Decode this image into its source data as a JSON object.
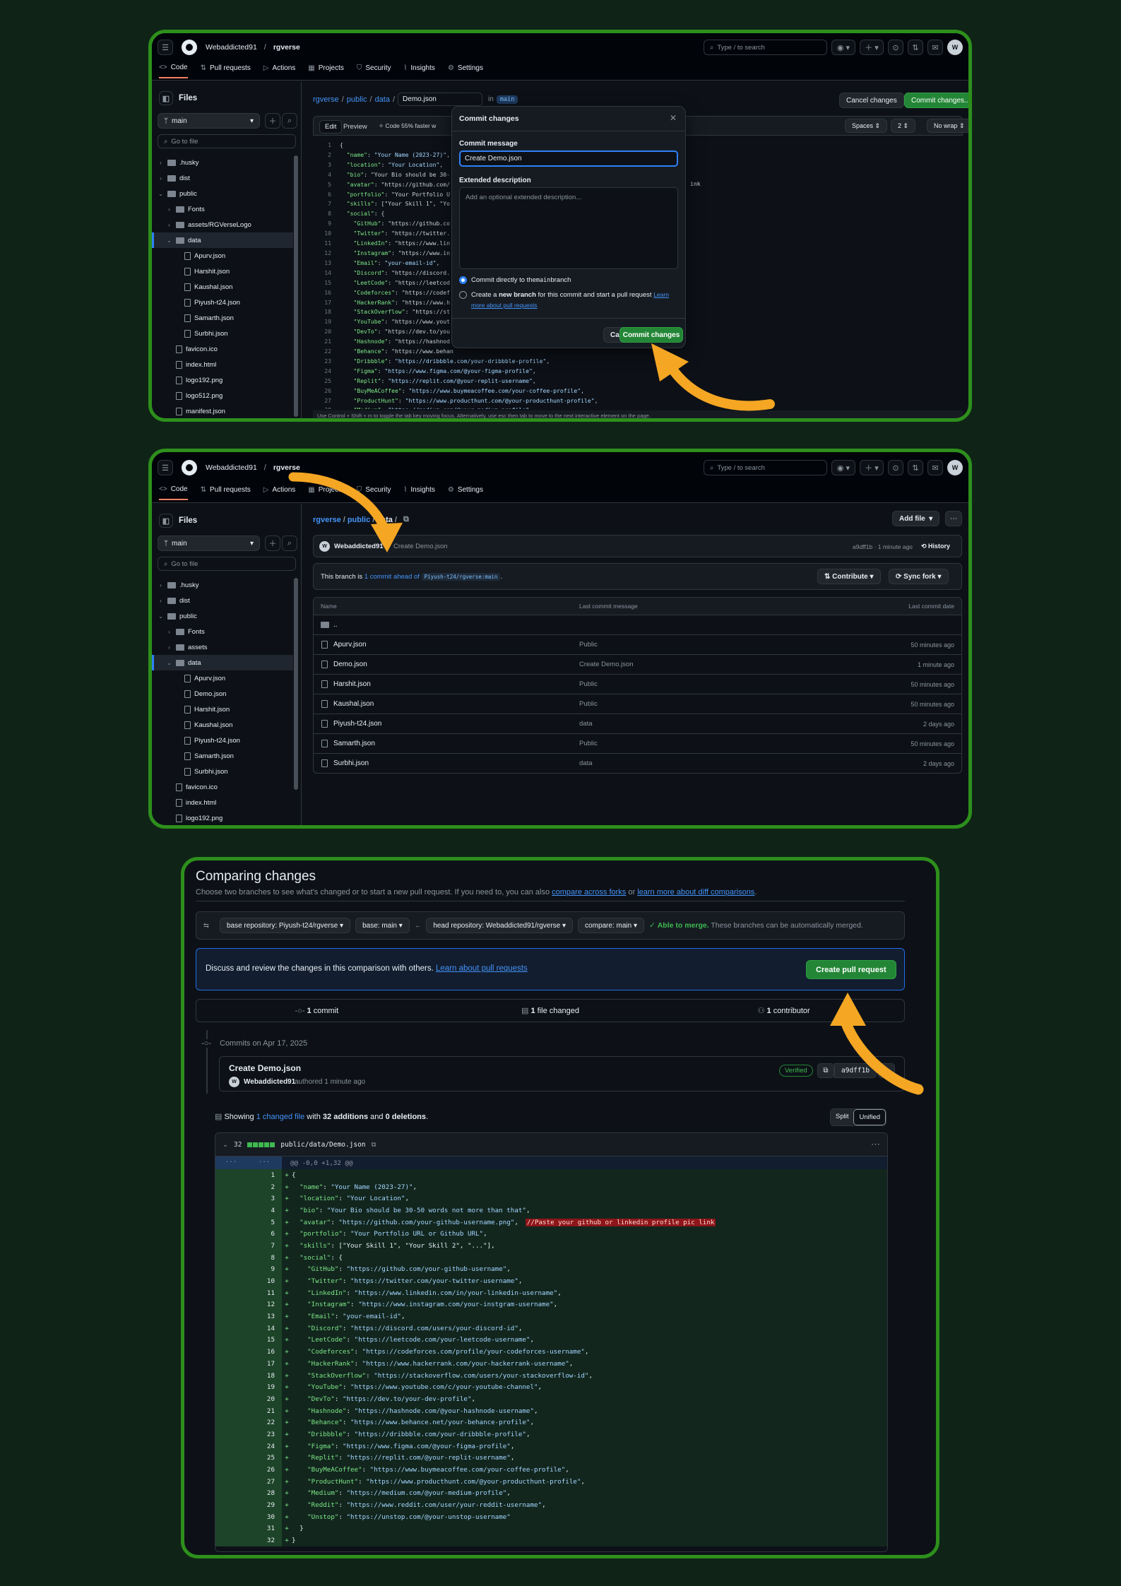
{
  "colors": {
    "page_bg": "#0f2416",
    "frame": "#2d8f1c",
    "bg": "#0d1117",
    "accent": "#238636",
    "arrow": "#f5a623",
    "link": "#4493f8"
  },
  "header": {
    "owner": "Webaddicted91",
    "repo": "rgverse",
    "search_placeholder": "Type / to search",
    "avatar": "W"
  },
  "tabs": [
    "Code",
    "Pull requests",
    "Actions",
    "Projects",
    "Security",
    "Insights",
    "Settings"
  ],
  "panel1": {
    "files_title": "Files",
    "branch": "main",
    "goto_placeholder": "Go to file",
    "tree": [
      {
        "t": "d",
        "n": ".husky",
        "l": 0
      },
      {
        "t": "d",
        "n": "dist",
        "l": 0
      },
      {
        "t": "do",
        "n": "public",
        "l": 0
      },
      {
        "t": "d",
        "n": "Fonts",
        "l": 1
      },
      {
        "t": "d",
        "n": "assets/RGVerseLogo",
        "l": 1
      },
      {
        "t": "do",
        "n": "data",
        "l": 1,
        "sel": true
      },
      {
        "t": "f",
        "n": "Apurv.json",
        "l": 2
      },
      {
        "t": "f",
        "n": "Harshit.json",
        "l": 2
      },
      {
        "t": "f",
        "n": "Kaushal.json",
        "l": 2
      },
      {
        "t": "f",
        "n": "Piyush-t24.json",
        "l": 2
      },
      {
        "t": "f",
        "n": "Samarth.json",
        "l": 2
      },
      {
        "t": "f",
        "n": "Surbhi.json",
        "l": 2
      },
      {
        "t": "f",
        "n": "favicon.ico",
        "l": 1
      },
      {
        "t": "f",
        "n": "index.html",
        "l": 1
      },
      {
        "t": "f",
        "n": "logo192.png",
        "l": 1
      },
      {
        "t": "f",
        "n": "logo512.png",
        "l": 1
      },
      {
        "t": "f",
        "n": "manifest.json",
        "l": 1
      }
    ],
    "path": [
      "rgverse",
      "public",
      "data"
    ],
    "filename": "Demo.json",
    "in_label": "in",
    "branch_pill": "main",
    "cancel_changes": "Cancel changes",
    "commit_changes": "Commit changes...",
    "edit_tab": "Edit",
    "preview_tab": "Preview",
    "code_hint": "Code 55% faster w",
    "spaces": "Spaces",
    "indent": "2",
    "wrap": "No wrap",
    "code_lines": [
      "{",
      "  \"name\": \"Your Name (2023-27)\",",
      "  \"location\": \"Your Location\",",
      "  \"bio\": \"Your Bio should be 30-",
      "  \"avatar\": \"https://github.com/",
      "  \"portfolio\": \"Your Portfolio U",
      "  \"skills\": [\"Your Skill 1\", \"Yo",
      "  \"social\": {",
      "    \"GitHub\": \"https://github.co",
      "    \"Twitter\": \"https://twitter.",
      "    \"LinkedIn\": \"https://www.lin",
      "    \"Instagram\": \"https://www.in",
      "    \"Email\": \"your-email-id\",",
      "    \"Discord\": \"https://discord.",
      "    \"LeetCode\": \"https://leetcod",
      "    \"Codeforces\": \"https://codef",
      "    \"HackerRank\": \"https://www.h",
      "    \"StackOverflow\": \"https://st",
      "    \"YouTube\": \"https://www.yout",
      "    \"DevTo\": \"https://dev.to/you",
      "    \"Hashnode\": \"https://hashnod",
      "    \"Behance\": \"https://www.behan",
      "    \"Dribbble\": \"https://dribbble.com/your-dribbble-profile\",",
      "    \"Figma\": \"https://www.figma.com/@your-figma-profile\",",
      "    \"Replit\": \"https://replit.com/@your-replit-username\",",
      "    \"BuyMeACoffee\": \"https://www.buymeacoffee.com/your-coffee-profile\",",
      "    \"ProductHunt\": \"https://www.producthunt.com/@your-producthunt-profile\",",
      "    \"Medium\": \"https://medium.com/@your-medium-profile\","
    ],
    "footer_hint": "Use Control + Shift + m to toggle the tab key moving focus. Alternatively, use esc then tab to move to the next interactive element on the page.",
    "modal": {
      "title": "Commit changes",
      "msg_label": "Commit message",
      "msg_value": "Create Demo.json",
      "ext_label": "Extended description",
      "ext_placeholder": "Add an optional extended description...",
      "opt1_pre": "Commit directly to the ",
      "opt1_code": "main",
      "opt1_post": " branch",
      "opt2_pre": "Create a ",
      "opt2_bold": "new branch",
      "opt2_post": " for this commit and start a pull request ",
      "opt2_link": "Learn more about pull requests",
      "cancel": "Cancel",
      "commit": "Commit changes"
    }
  },
  "panel2": {
    "tree": [
      {
        "t": "d",
        "n": ".husky",
        "l": 0
      },
      {
        "t": "d",
        "n": "dist",
        "l": 0
      },
      {
        "t": "do",
        "n": "public",
        "l": 0
      },
      {
        "t": "d",
        "n": "Fonts",
        "l": 1
      },
      {
        "t": "d",
        "n": "assets",
        "l": 1
      },
      {
        "t": "do",
        "n": "data",
        "l": 1,
        "sel": true
      },
      {
        "t": "f",
        "n": "Apurv.json",
        "l": 2
      },
      {
        "t": "f",
        "n": "Demo.json",
        "l": 2
      },
      {
        "t": "f",
        "n": "Harshit.json",
        "l": 2
      },
      {
        "t": "f",
        "n": "Kaushal.json",
        "l": 2
      },
      {
        "t": "f",
        "n": "Piyush-t24.json",
        "l": 2
      },
      {
        "t": "f",
        "n": "Samarth.json",
        "l": 2
      },
      {
        "t": "f",
        "n": "Surbhi.json",
        "l": 2
      },
      {
        "t": "f",
        "n": "favicon.ico",
        "l": 1
      },
      {
        "t": "f",
        "n": "index.html",
        "l": 1
      },
      {
        "t": "f",
        "n": "logo192.png",
        "l": 1
      }
    ],
    "path": [
      "rgverse",
      "public",
      "data"
    ],
    "add_file": "Add file",
    "commit_author": "Webaddicted91",
    "commit_msg": "Create Demo.json",
    "commit_meta": "a9dff1b · 1 minute ago",
    "history": "History",
    "ahead_pre": "This branch is ",
    "ahead_link": "1 commit ahead of",
    "ahead_code": "Piyush-t24/rgverse:main",
    "ahead_post": ".",
    "contribute": "Contribute",
    "sync": "Sync fork",
    "cols": [
      "Name",
      "Last commit message",
      "Last commit date"
    ],
    "parent": "..",
    "rows": [
      {
        "name": "Apurv.json",
        "msg": "Public",
        "date": "50 minutes ago"
      },
      {
        "name": "Demo.json",
        "msg": "Create Demo.json",
        "date": "1 minute ago"
      },
      {
        "name": "Harshit.json",
        "msg": "Public",
        "date": "50 minutes ago"
      },
      {
        "name": "Kaushal.json",
        "msg": "Public",
        "date": "50 minutes ago"
      },
      {
        "name": "Piyush-t24.json",
        "msg": "data",
        "date": "2 days ago"
      },
      {
        "name": "Samarth.json",
        "msg": "Public",
        "date": "50 minutes ago"
      },
      {
        "name": "Surbhi.json",
        "msg": "data",
        "date": "2 days ago"
      }
    ]
  },
  "panel3": {
    "title": "Comparing changes",
    "subtitle_pre": "Choose two branches to see what's changed or to start a new pull request. If you need to, you can also ",
    "subtitle_link1": "compare across forks",
    "subtitle_mid": " or ",
    "subtitle_link2": "learn more about diff comparisons",
    "subtitle_end": ".",
    "base_repo": "base repository: Piyush-t24/rgverse",
    "base": "base: main",
    "head_repo": "head repository: Webaddicted91/rgverse",
    "compare": "compare: main",
    "able": "Able to merge.",
    "able_rest": " These branches can be automatically merged.",
    "discuss": "Discuss and review the changes in this comparison with others. ",
    "discuss_link": "Learn about pull requests",
    "create_pr": "Create pull request",
    "stat_commits_n": "1",
    "stat_commits": "commit",
    "stat_files_n": "1",
    "stat_files": "file changed",
    "stat_contrib_n": "1",
    "stat_contrib": "contributor",
    "commits_on": "Commits on Apr 17, 2025",
    "commit_title": "Create Demo.json",
    "commit_author": "Webaddicted91",
    "commit_meta": "authored 1 minute ago",
    "verified": "Verified",
    "sha": "a9dff1b",
    "showing_pre": "Showing ",
    "showing_link": "1 changed file",
    "showing_mid": " with ",
    "additions": "32 additions",
    "and": " and ",
    "deletions": "0 deletions",
    "showing_end": ".",
    "split": "Split",
    "unified": "Unified",
    "diff_count": "32",
    "diff_path": "public/data/Demo.json",
    "hunk": "@@ -0,0 +1,32 @@",
    "hunk_dots": "...",
    "comment": "//Paste your github or linkedin profile pic link",
    "diff_lines": [
      "{",
      "  \"name\": \"Your Name (2023-27)\",",
      "  \"location\": \"Your Location\",",
      "  \"bio\": \"Your Bio should be 30-50 words not more than that\",",
      "  \"avatar\": \"https://github.com/your-github-username.png\",",
      "  \"portfolio\": \"Your Portfolio URL or Github URL\",",
      "  \"skills\": [\"Your Skill 1\", \"Your Skill 2\", \"...\"],",
      "  \"social\": {",
      "    \"GitHub\": \"https://github.com/your-github-username\",",
      "    \"Twitter\": \"https://twitter.com/your-twitter-username\",",
      "    \"LinkedIn\": \"https://www.linkedin.com/in/your-linkedin-username\",",
      "    \"Instagram\": \"https://www.instagram.com/your-instgram-username\",",
      "    \"Email\": \"your-email-id\",",
      "    \"Discord\": \"https://discord.com/users/your-discord-id\",",
      "    \"LeetCode\": \"https://leetcode.com/your-leetcode-username\",",
      "    \"Codeforces\": \"https://codeforces.com/profile/your-codeforces-username\",",
      "    \"HackerRank\": \"https://www.hackerrank.com/your-hackerrank-username\",",
      "    \"StackOverflow\": \"https://stackoverflow.com/users/your-stackoverflow-id\",",
      "    \"YouTube\": \"https://www.youtube.com/c/your-youtube-channel\",",
      "    \"DevTo\": \"https://dev.to/your-dev-profile\",",
      "    \"Hashnode\": \"https://hashnode.com/@your-hashnode-username\",",
      "    \"Behance\": \"https://www.behance.net/your-behance-profile\",",
      "    \"Dribbble\": \"https://dribbble.com/your-dribbble-profile\",",
      "    \"Figma\": \"https://www.figma.com/@your-figma-profile\",",
      "    \"Replit\": \"https://replit.com/@your-replit-username\",",
      "    \"BuyMeACoffee\": \"https://www.buymeacoffee.com/your-coffee-profile\",",
      "    \"ProductHunt\": \"https://www.producthunt.com/@your-producthunt-profile\",",
      "    \"Medium\": \"https://medium.com/@your-medium-profile\",",
      "    \"Reddit\": \"https://www.reddit.com/user/your-reddit-username\",",
      "    \"Unstop\": \"https://unstop.com/@your-unstop-username\"",
      "  }",
      "}"
    ]
  }
}
